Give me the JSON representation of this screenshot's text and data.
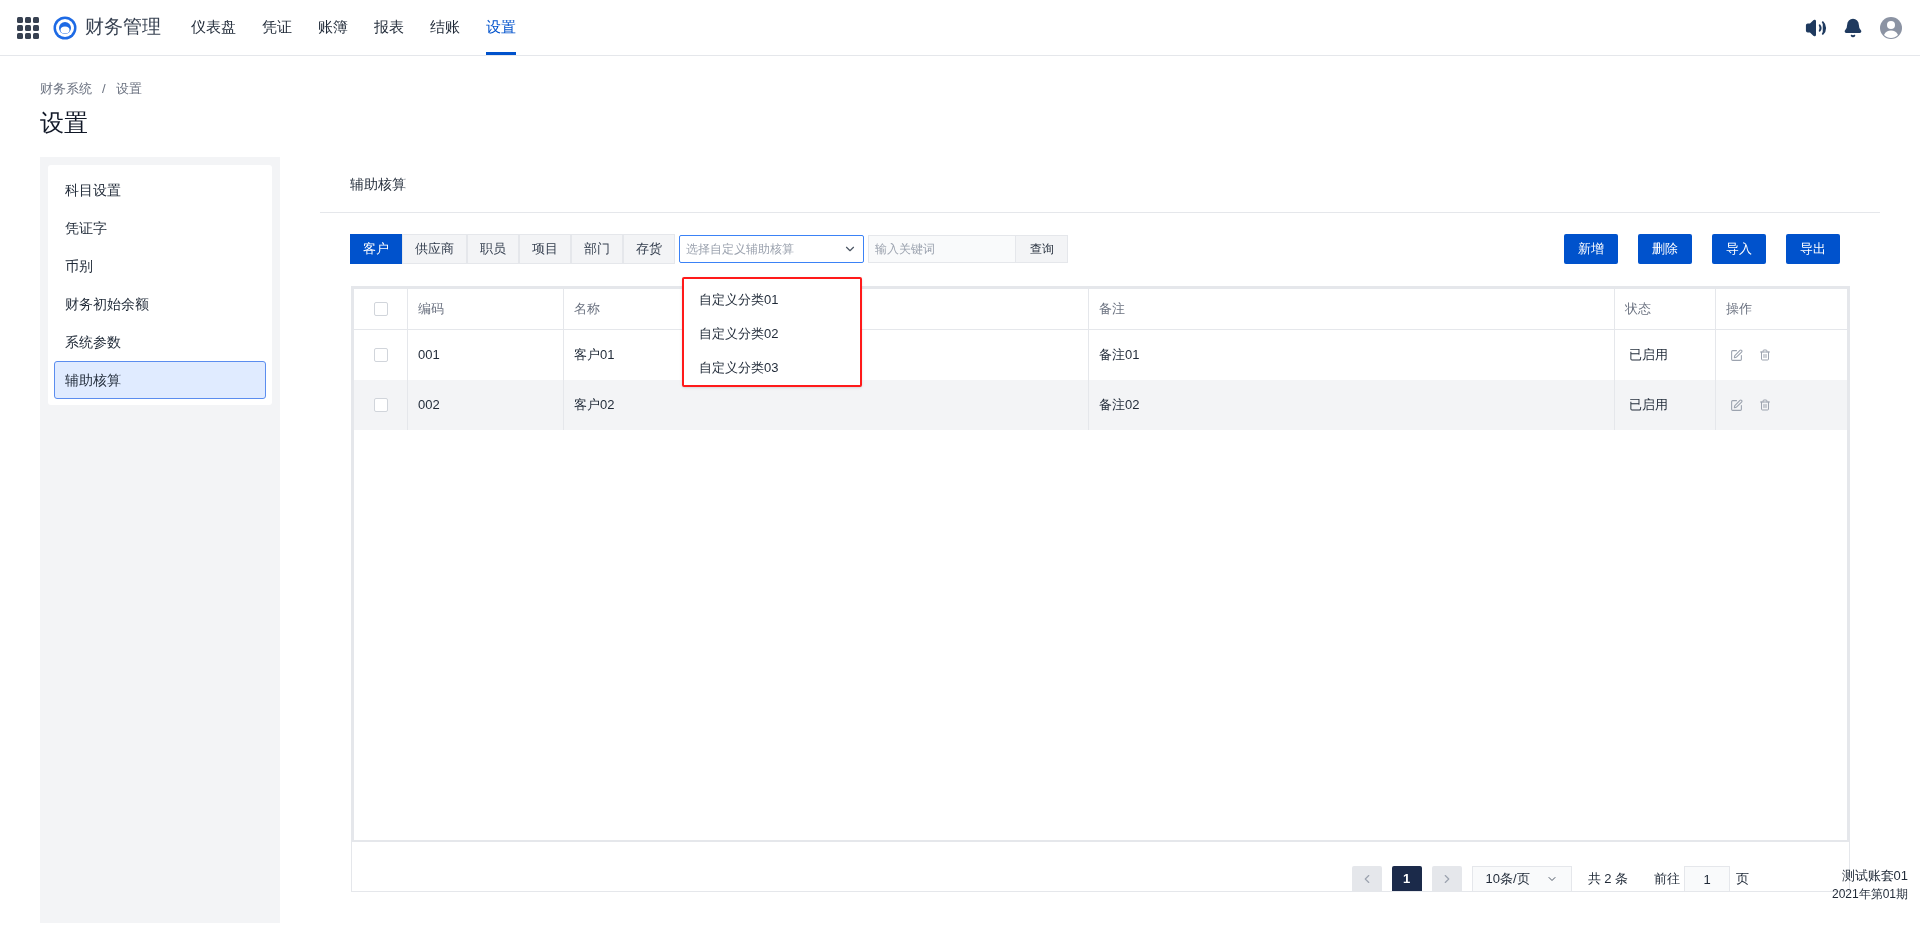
{
  "app": {
    "title": "财务管理"
  },
  "nav": [
    {
      "label": "仪表盘",
      "selected": false
    },
    {
      "label": "凭证",
      "selected": false
    },
    {
      "label": "账簿",
      "selected": false
    },
    {
      "label": "报表",
      "selected": false
    },
    {
      "label": "结账",
      "selected": false
    },
    {
      "label": "设置",
      "selected": true
    }
  ],
  "breadcrumb": {
    "items": [
      "财务系统",
      "设置"
    ],
    "separator": "/"
  },
  "page_title": "设置",
  "sidebar": {
    "items": [
      {
        "label": "科目设置",
        "selected": false
      },
      {
        "label": "凭证字",
        "selected": false
      },
      {
        "label": "币别",
        "selected": false
      },
      {
        "label": "财务初始余额",
        "selected": false
      },
      {
        "label": "系统参数",
        "selected": false
      },
      {
        "label": "辅助核算",
        "selected": true
      }
    ]
  },
  "section_title": "辅助核算",
  "category_tabs": [
    {
      "label": "客户",
      "selected": true
    },
    {
      "label": "供应商",
      "selected": false
    },
    {
      "label": "职员",
      "selected": false
    },
    {
      "label": "项目",
      "selected": false
    },
    {
      "label": "部门",
      "selected": false
    },
    {
      "label": "存货",
      "selected": false
    }
  ],
  "custom_select": {
    "placeholder": "选择自定义辅助核算",
    "expanded": true,
    "options": [
      "自定义分类01",
      "自定义分类02",
      "自定义分类03"
    ]
  },
  "search": {
    "placeholder": "输入关键词",
    "button": "查询"
  },
  "actions": [
    "新增",
    "删除",
    "导入",
    "导出"
  ],
  "table": {
    "header_checked": false,
    "columns": [
      "编码",
      "名称",
      "备注",
      "状态",
      "操作"
    ],
    "rows": [
      {
        "checked": false,
        "code": "001",
        "name": "客户01",
        "note": "备注01",
        "status": "已启用"
      },
      {
        "checked": false,
        "code": "002",
        "name": "客户02",
        "note": "备注02",
        "status": "已启用"
      }
    ]
  },
  "pagination": {
    "pages": [
      {
        "label": "1",
        "selected": true
      }
    ],
    "page_size": "10条/页",
    "total": "共 2 条",
    "goto_label": "前往",
    "goto_value": "1",
    "goto_suffix": "页"
  },
  "account": {
    "name": "测试账套01",
    "period": "2021年第01期"
  }
}
